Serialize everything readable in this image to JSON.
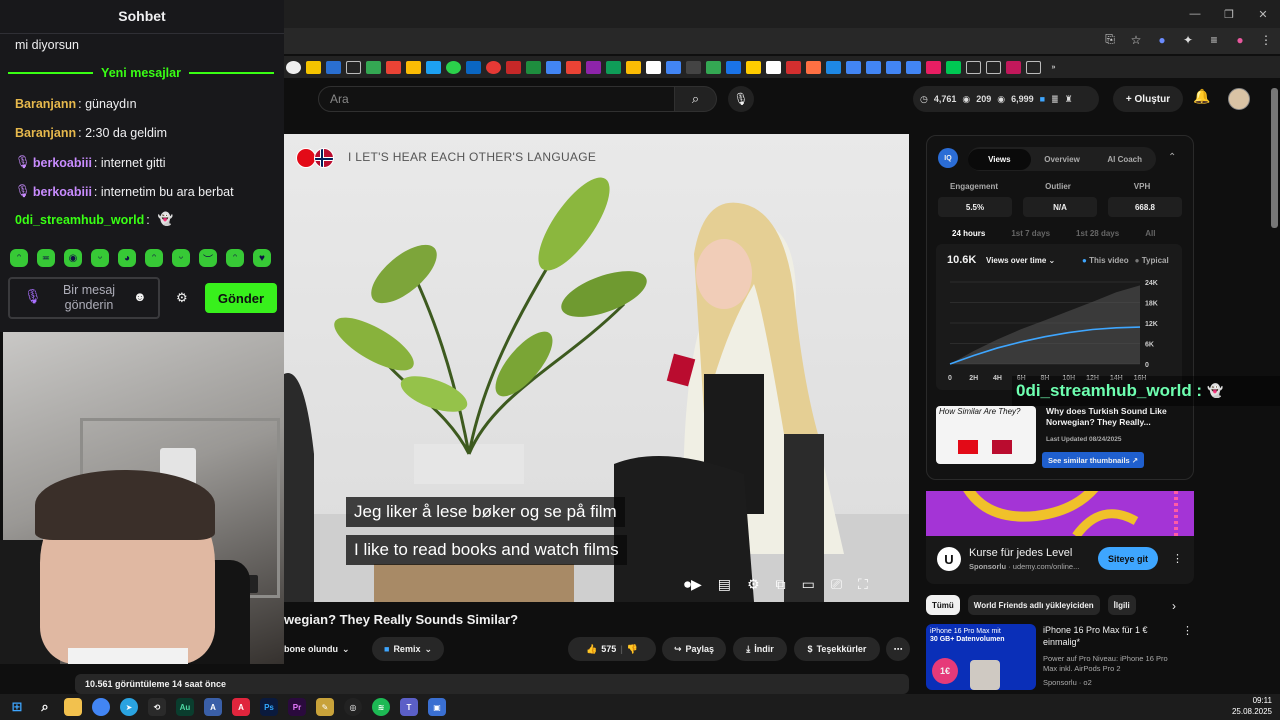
{
  "chat": {
    "title": "Sohbet",
    "prev_message": "mi diyorsun",
    "new_messages_label": "Yeni mesajlar",
    "messages": [
      {
        "user": "Baranjann",
        "text": ": günaydın",
        "color": "#e6b84c"
      },
      {
        "user": "Baranjann",
        "text": ": 2:30 da geldim",
        "color": "#e6b84c"
      },
      {
        "user": "berkoabiii",
        "text": ": internet gitti",
        "color": "#c98cff"
      },
      {
        "user": "berkoabiii",
        "text": ": internetim bu ara berbat",
        "color": "#c98cff"
      },
      {
        "user": "0di_streamhub_world",
        "text": ":",
        "color": "#39ff14"
      }
    ],
    "input_placeholder": "Bir mesaj gönderin",
    "send_label": "Gönder"
  },
  "youtube": {
    "search_placeholder": "Ara",
    "stats": {
      "a": "4,761",
      "b": "209",
      "c": "6,999"
    },
    "create_label": "Oluştur",
    "video": {
      "top_caption": "I  LET'S HEAR EACH OTHER'S LANGUAGE",
      "subtitle_no": "Jeg liker å lese bøker og se på film",
      "subtitle_en": "I like to read books and watch films",
      "title": "wegian? They Really Sounds Similar?",
      "subscribed": "bone olundu",
      "remix": "Remix",
      "likes": "575",
      "share": "Paylaş",
      "download": "İndir",
      "thanks": "Teşekkürler",
      "views_line": "10.561 görüntüleme  14 saat önce"
    },
    "iq": {
      "tabs": [
        "Views",
        "Overview",
        "AI Coach"
      ],
      "metrics": [
        {
          "label": "Engagement",
          "value": "5.5%"
        },
        {
          "label": "Outlier",
          "value": "N/A"
        },
        {
          "label": "VPH",
          "value": "668.8"
        }
      ],
      "periods": [
        "24 hours",
        "1st 7 days",
        "1st 28 days",
        "All"
      ],
      "views_count": "10.6K",
      "views_over_time": "Views over time",
      "legend_this": "This video",
      "legend_typical": "Typical",
      "similar_title": "Why does Turkish Sound Like Norwegian? They Really...",
      "similar_updated": "Last Updated 08/24/2025",
      "similar_button": "See similar thumbnails ↗",
      "thumb_text": "How Similar Are They?"
    },
    "ad": {
      "title": "Kurse für jedes Level",
      "sponsor": "Sponsorlu",
      "domain": "· udemy.com/online...",
      "button": "Siteye git"
    },
    "chips": [
      "Tümü",
      "World Friends adlı yükleyiciden",
      "İlgili"
    ],
    "iphone_ad": {
      "title": "iPhone 16 Pro Max für 1 € einmalig*",
      "desc": "Power auf Pro Niveau: iPhone 16 Pro Max inkl. AirPods Pro 2",
      "sponsor": "Sponsorlu · o2",
      "thumb_line1": "iPhone 16 Pro Max mit",
      "thumb_line2": "30 GB+ Datenvolumen",
      "price": "1€"
    }
  },
  "overlay": {
    "name": "0di_streamhub_world :"
  },
  "taskbar": {
    "time": "09:11",
    "date": "25.08.2025"
  },
  "chart_data": {
    "type": "area",
    "x": [
      "0",
      "2H",
      "4H",
      "6H",
      "8H",
      "10H",
      "12H",
      "14H",
      "16H"
    ],
    "ylim": [
      0,
      24000
    ],
    "yticks": [
      "24K",
      "18K",
      "12K",
      "6K",
      "0"
    ],
    "series": [
      {
        "name": "This video",
        "values": [
          0,
          2500,
          4700,
          6500,
          8000,
          9200,
          10100,
          10600,
          10800
        ],
        "color": "#3ea6ff"
      },
      {
        "name": "Typical",
        "values": [
          0,
          3800,
          7200,
          10200,
          12800,
          15500,
          18200,
          21000,
          23000
        ],
        "color": "#555555"
      }
    ]
  }
}
